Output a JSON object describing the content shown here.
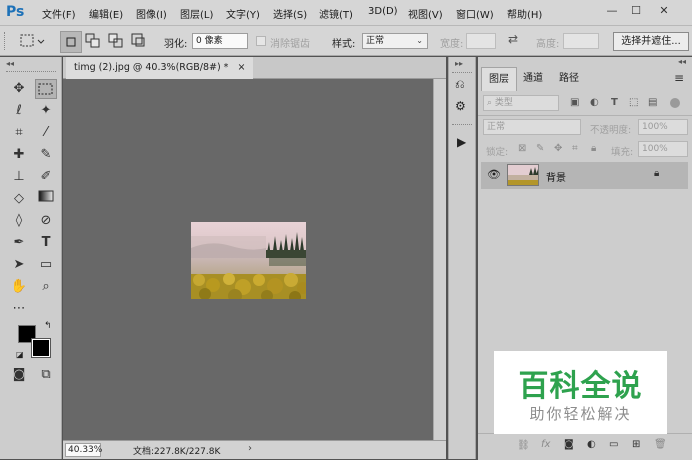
{
  "app": {
    "logo": "Ps",
    "brand_color": "#1d71b8"
  },
  "menu": [
    "文件(F)",
    "编辑(E)",
    "图像(I)",
    "图层(L)",
    "文字(Y)",
    "选择(S)",
    "滤镜(T)",
    "3D(D)",
    "视图(V)",
    "窗口(W)",
    "帮助(H)"
  ],
  "window_controls": {
    "minimize": "—",
    "restore": "☐",
    "close": "✕"
  },
  "options": {
    "feather_label": "羽化:",
    "feather_value": "0 像素",
    "antialias_label": "消除锯齿",
    "style_label": "样式:",
    "style_value": "正常",
    "width_label": "宽度:",
    "height_label": "高度:",
    "select_mask_button": "选择并遮住..."
  },
  "document": {
    "tab_title": "timg (2).jpg @ 40.3%(RGB/8#) *",
    "tab_close": "×",
    "zoom": "40.33%",
    "doc_size": "文档:227.8K/227.8K",
    "status_arrow": "›"
  },
  "layers_panel": {
    "tabs": [
      "图层",
      "通道",
      "路径"
    ],
    "filter_kind": "类型",
    "blend_mode": "正常",
    "opacity_label": "不透明度:",
    "opacity_value": "100%",
    "lock_label": "锁定:",
    "fill_label": "填充:",
    "fill_value": "100%",
    "layers": [
      {
        "name": "背景",
        "visible": true,
        "locked": true
      }
    ]
  },
  "watermark": {
    "title": "百科全说",
    "subtitle": "助你轻松解决",
    "title_color": "#2ea24e"
  }
}
